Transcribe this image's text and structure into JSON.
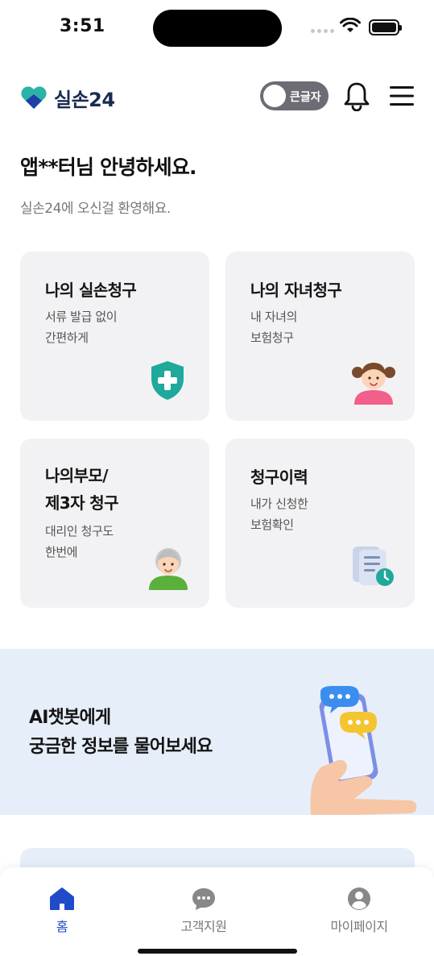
{
  "status_bar": {
    "time": "3:51"
  },
  "header": {
    "logo_text": "실손24",
    "bigtext_label": "큰글자",
    "icons": [
      "heart-logo-icon",
      "bell-icon",
      "hamburger-menu-icon"
    ]
  },
  "greeting": {
    "title": "앱**터님 안녕하세요.",
    "subtitle": "실손24에 오신걸 환영해요."
  },
  "cards": [
    {
      "title": "나의 실손청구",
      "desc_line1": "서류 발급 없이",
      "desc_line2": "간편하게",
      "icon": "shield-plus-icon"
    },
    {
      "title": "나의 자녀청구",
      "desc_line1": "내 자녀의",
      "desc_line2": "보험청구",
      "icon": "child-icon"
    },
    {
      "title_line1": "나의부모/",
      "title_line2": "제3자 청구",
      "desc_line1": "대리인 청구도",
      "desc_line2": "한번에",
      "icon": "grandparent-icon"
    },
    {
      "title": "청구이력",
      "desc_line1": "내가 신청한",
      "desc_line2": "보험확인",
      "icon": "document-clock-icon"
    }
  ],
  "banner": {
    "line1": "AI챗봇에게",
    "line2": "궁금한 정보를 물어보세요",
    "icon": "phone-chat-icon"
  },
  "bottom_nav": [
    {
      "label": "홈",
      "icon": "home-icon",
      "active": true
    },
    {
      "label": "고객지원",
      "icon": "chat-bubble-icon",
      "active": false
    },
    {
      "label": "마이페이지",
      "icon": "user-circle-icon",
      "active": false
    }
  ],
  "colors": {
    "brand_navy": "#1a2a52",
    "brand_teal": "#2ab3a6",
    "active_blue": "#1f4bc9",
    "card_bg": "#f2f2f4",
    "banner_bg": "#e6eef9"
  }
}
